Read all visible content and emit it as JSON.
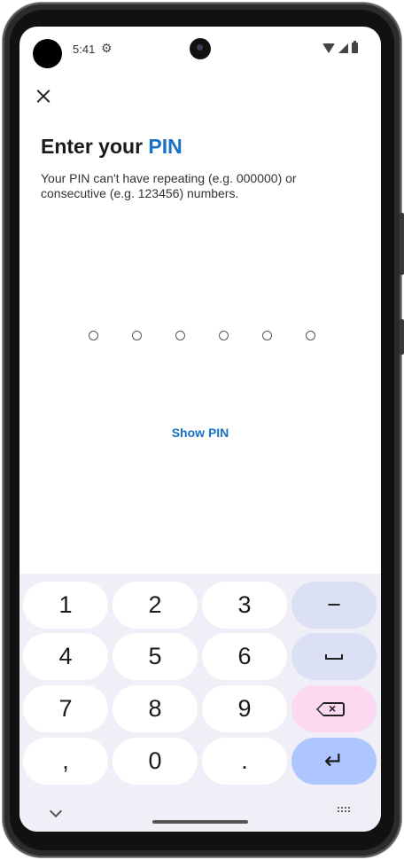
{
  "status_bar": {
    "time": "5:41",
    "settings_icon": "gear-icon"
  },
  "header": {
    "title_prefix": "Enter your ",
    "title_accent": "PIN",
    "subtitle": "Your PIN can't have repeating (e.g. 000000) or consecutive (e.g. 123456) numbers."
  },
  "pin": {
    "length": 6,
    "filled": 0
  },
  "actions": {
    "show_pin": "Show PIN"
  },
  "keyboard": {
    "keys": [
      [
        "1",
        "2",
        "3",
        "−"
      ],
      [
        "4",
        "5",
        "6",
        "space"
      ],
      [
        "7",
        "8",
        "9",
        "backspace"
      ],
      [
        ",",
        "0",
        ".",
        "enter"
      ]
    ],
    "labels": {
      "k1": "1",
      "k2": "2",
      "k3": "3",
      "minus": "−",
      "k4": "4",
      "k5": "5",
      "k6": "6",
      "k7": "7",
      "k8": "8",
      "k9": "9",
      "comma": ",",
      "k0": "0",
      "period": ".",
      "enter": "↵"
    }
  },
  "colors": {
    "accent": "#1671c7",
    "func_key": "#dbe0f5",
    "delete_key": "#fcd9f1",
    "enter_key": "#aec6ff"
  }
}
